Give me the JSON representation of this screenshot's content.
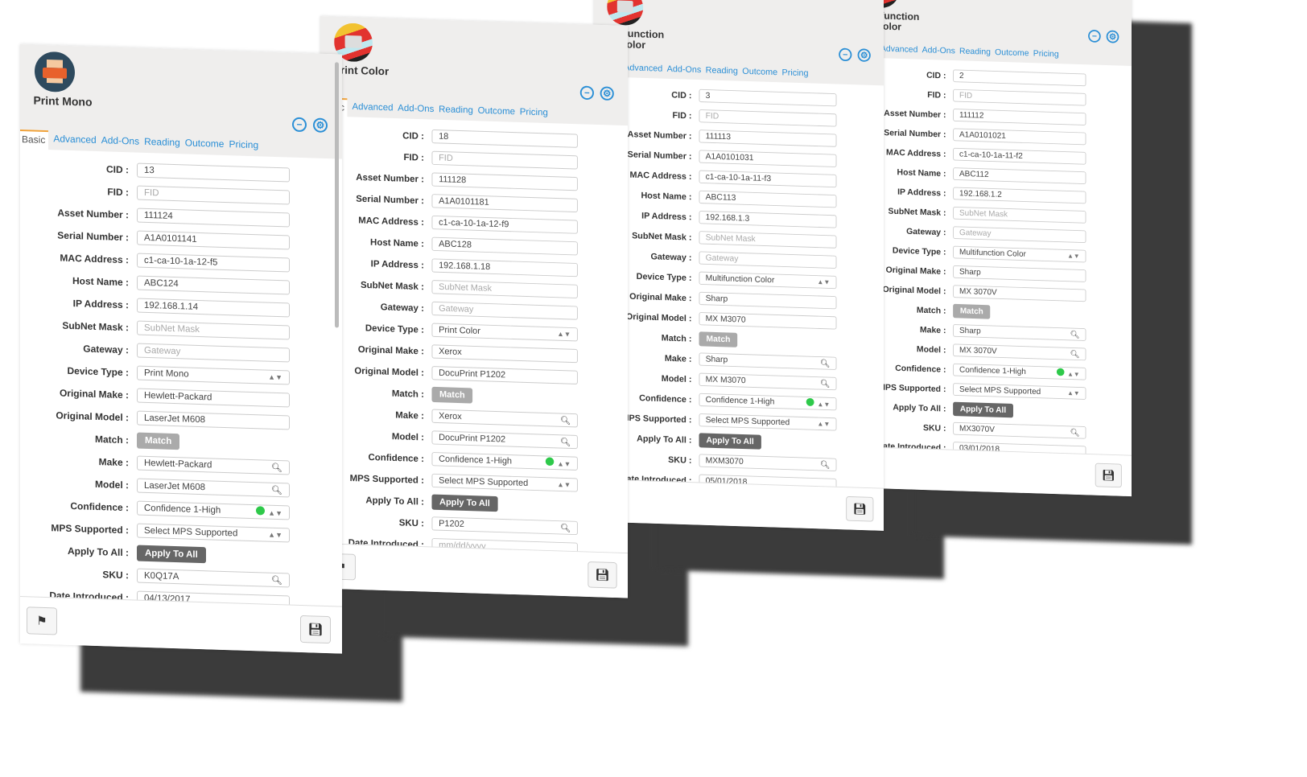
{
  "tabs": [
    "Basic",
    "Advanced",
    "Add-Ons",
    "Reading",
    "Outcome",
    "Pricing"
  ],
  "labels": {
    "cid": "CID :",
    "fid": "FID :",
    "asset": "Asset Number :",
    "serial": "Serial Number :",
    "mac": "MAC Address :",
    "host": "Host Name :",
    "ip": "IP Address :",
    "subnet": "SubNet Mask :",
    "gateway": "Gateway :",
    "device_type": "Device Type :",
    "orig_make": "Original Make :",
    "orig_model": "Original Model :",
    "match": "Match :",
    "make": "Make :",
    "model": "Model :",
    "confidence": "Confidence :",
    "mps": "MPS Supported :",
    "apply": "Apply To All :",
    "sku": "SKU :",
    "date": "Date Introduced :"
  },
  "placeholders": {
    "fid": "FID",
    "subnet": "SubNet Mask",
    "gateway": "Gateway",
    "date": "mm/dd/yyyy"
  },
  "buttons": {
    "match": "Match",
    "apply": "Apply To All"
  },
  "colors": {
    "accent": "#2b8fd6",
    "confidence_high": "#2ec94a",
    "tab_active": "#f0a23a"
  },
  "cards": [
    {
      "title": "Print Mono",
      "icon": "printer-mono-icon",
      "cid": "13",
      "asset": "111124",
      "serial": "A1A0101141",
      "mac": "c1-ca-10-1a-12-f5",
      "host": "ABC124",
      "ip": "192.168.1.14",
      "device_type": "Print Mono",
      "orig_make": "Hewlett-Packard",
      "orig_model": "LaserJet M608",
      "make": "Hewlett-Packard",
      "model": "LaserJet M608",
      "confidence": "Confidence 1-High",
      "mps": "Select MPS Supported",
      "sku": "K0Q17A",
      "date": "04/13/2017"
    },
    {
      "title": "Print Color",
      "icon": "printer-color-icon",
      "cid": "18",
      "asset": "111128",
      "serial": "A1A0101181",
      "mac": "c1-ca-10-1a-12-f9",
      "host": "ABC128",
      "ip": "192.168.1.18",
      "device_type": "Print Color",
      "orig_make": "Xerox",
      "orig_model": "DocuPrint P1202",
      "make": "Xerox",
      "model": "DocuPrint P1202",
      "confidence": "Confidence 1-High",
      "mps": "Select MPS Supported",
      "sku": "P1202",
      "date": ""
    },
    {
      "title": "Multifunction Color",
      "icon": "multifunction-icon",
      "cid": "3",
      "asset": "111113",
      "serial": "A1A0101031",
      "mac": "c1-ca-10-1a-11-f3",
      "host": "ABC113",
      "ip": "192.168.1.3",
      "device_type": "Multifunction Color",
      "orig_make": "Sharp",
      "orig_model": "MX M3070",
      "make": "Sharp",
      "model": "MX M3070",
      "confidence": "Confidence 1-High",
      "mps": "Select MPS Supported",
      "sku": "MXM3070",
      "date": "05/01/2018"
    },
    {
      "title": "Multifunction Color",
      "icon": "multifunction-icon",
      "cid": "2",
      "asset": "111112",
      "serial": "A1A0101021",
      "mac": "c1-ca-10-1a-11-f2",
      "host": "ABC112",
      "ip": "192.168.1.2",
      "device_type": "Multifunction Color",
      "orig_make": "Sharp",
      "orig_model": "MX 3070V",
      "make": "Sharp",
      "model": "MX 3070V",
      "confidence": "Confidence 1-High",
      "mps": "Select MPS Supported",
      "sku": "MX3070V",
      "date": "03/01/2018"
    }
  ]
}
